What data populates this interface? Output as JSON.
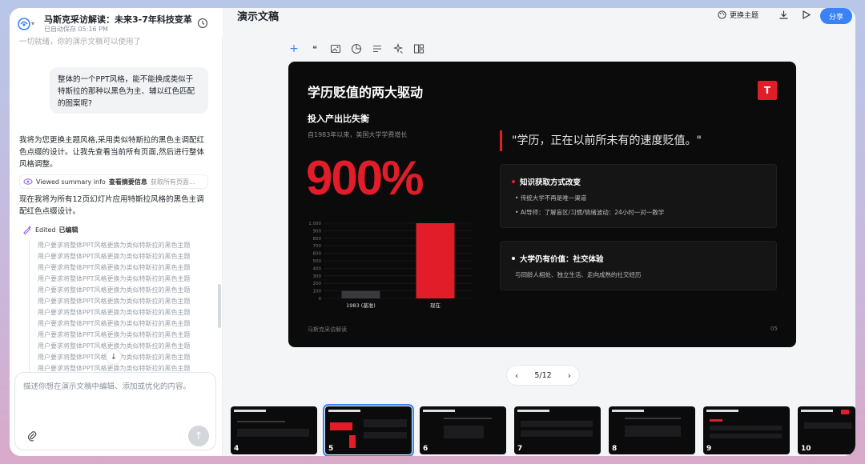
{
  "chat": {
    "doc_title": "马斯克采访解读：未来3-7年科技变革",
    "saved_status": "已自动保存 05:16 PM",
    "faded_previous": "一切就绪，你的演示文稿可以使用了",
    "user_message": "整体的一个PPT风格，能不能换成类似于特斯拉的那种以黑色为主、辅以红色匹配的图案呢?",
    "ai_message_1": "我将为您更换主题风格,采用类似特斯拉的黑色主调配红色点缀的设计。让我先查看当前所有页面,然后进行整体风格调整。",
    "tool_viewed": {
      "label": "Viewed summary info",
      "bold": "查看摘要信息",
      "extra": "获取所有页面..."
    },
    "ai_message_2": "现在我将为所有12页幻灯片应用特斯拉风格的黑色主调配红色点缀设计。",
    "tool_edited": {
      "label": "Edited",
      "bold": "已编辑"
    },
    "edit_items": [
      "用户要求将整体PPT风格更换为类似特斯拉的黑色主题",
      "用户要求将整体PPT风格更换为类似特斯拉的黑色主题",
      "用户要求将整体PPT风格更换为类似特斯拉的黑色主题",
      "用户要求将整体PPT风格更换为类似特斯拉的黑色主题",
      "用户要求将整体PPT风格更换为类似特斯拉的黑色主题",
      "用户要求将整体PPT风格更换为类似特斯拉的黑色主题",
      "用户要求将整体PPT风格更换为类似特斯拉的黑色主题",
      "用户要求将整体PPT风格更换为类似特斯拉的黑色主题",
      "用户要求将整体PPT风格更换为类似特斯拉的黑色主题",
      "用户要求将整体PPT风格更换为类似特斯拉的黑色主题",
      "用户要求将整体PPT风格更换为类似特斯拉的黑色主题",
      "用户要求将整体PPT风格更换为类似特斯拉的黑色主题"
    ],
    "input_placeholder": "描述你想在演示文稿中编辑、添加或优化的内容。"
  },
  "editor": {
    "title": "演示文稿",
    "theme_button": "更换主题",
    "share_button": "分享",
    "toolbar_icons": [
      "plus-icon",
      "quote-icon",
      "image-icon",
      "chart-icon",
      "align-icon",
      "magic-icon",
      "layout-icon"
    ]
  },
  "slide": {
    "title": "学历贬值的两大驱动",
    "logo_letter": "T",
    "subtitle": "投入产出比失衡",
    "caption": "自1983年以来，美国大学学费增长",
    "big_number": "900%",
    "quote": "\"学历，正在以前所未有的速度贬值。\"",
    "card1": {
      "title": "知识获取方式改变",
      "lines": [
        "传统大学不再是唯一渠道",
        "AI导师：了解盲区/习惯/情绪波动：24小时一对一教学"
      ]
    },
    "card2": {
      "title": "大学仍有价值：社交体验",
      "line": "与同龄人相处、独立生活、走向成熟的社交经历"
    },
    "footer": "马斯克采访解读",
    "page": "05"
  },
  "chart_data": {
    "type": "bar",
    "categories": [
      "1983 (基准)",
      "现在"
    ],
    "values": [
      100,
      1000
    ],
    "ylim": [
      0,
      1000
    ],
    "yticks": [
      "0",
      "100",
      "200",
      "300",
      "400",
      "500",
      "600",
      "700",
      "800",
      "900",
      "1,000"
    ],
    "colors": [
      "#3a3a3c",
      "#e11d2a"
    ]
  },
  "pager": {
    "current": "5/12"
  },
  "thumbnails": [
    "4",
    "5",
    "6",
    "7",
    "8",
    "9",
    "10"
  ],
  "colors": {
    "accent": "#e11d2a",
    "primary_blue": "#3b82f6",
    "slide_bg": "#0b0b0c"
  }
}
